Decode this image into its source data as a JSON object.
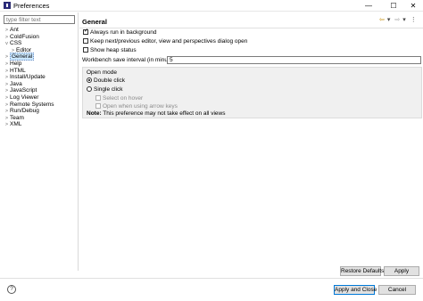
{
  "window": {
    "title": "Preferences",
    "minimize": "—",
    "maximize": "☐",
    "close": "✕"
  },
  "filter": {
    "placeholder": "type filter text"
  },
  "tree": [
    {
      "label": "Ant",
      "twisty": ">"
    },
    {
      "label": "ColdFusion",
      "twisty": ">"
    },
    {
      "label": "CSS",
      "twisty": "v"
    },
    {
      "label": "Editor",
      "twisty": ">"
    },
    {
      "label": "General",
      "twisty": ">"
    },
    {
      "label": "Help",
      "twisty": ">"
    },
    {
      "label": "HTML",
      "twisty": ">"
    },
    {
      "label": "Install/Update",
      "twisty": ">"
    },
    {
      "label": "Java",
      "twisty": ">"
    },
    {
      "label": "JavaScript",
      "twisty": ">"
    },
    {
      "label": "Log Viewer",
      "twisty": ">"
    },
    {
      "label": "Remote Systems",
      "twisty": ">"
    },
    {
      "label": "Run/Debug",
      "twisty": ">"
    },
    {
      "label": "Team",
      "twisty": ">"
    },
    {
      "label": "XML",
      "twisty": ">"
    }
  ],
  "page": {
    "title": "General",
    "nav": {
      "back": "⇦",
      "back_menu": "▾",
      "forward": "⇨",
      "forward_menu": "▾",
      "more": "⋮"
    },
    "checkboxes": [
      {
        "label": "Always run in background",
        "checked": true
      },
      {
        "label": "Keep next/previous editor, view and perspectives dialog open",
        "checked": false
      },
      {
        "label": "Show heap status",
        "checked": false
      }
    ],
    "interval_label": "Workbench save interval (in minutes):",
    "interval_value": "5",
    "open_mode": {
      "title": "Open mode",
      "double_click": "Double click",
      "single_click": "Single click",
      "select_on_hover": "Select on hover",
      "open_with_arrows": "Open when using arrow keys",
      "note_prefix": "Note:",
      "note_text": " This preference may not take effect on all views"
    },
    "restore_defaults": "Restore Defaults",
    "apply": "Apply"
  },
  "footer": {
    "help": "?",
    "apply_and_close": "Apply and Close",
    "cancel": "Cancel"
  }
}
